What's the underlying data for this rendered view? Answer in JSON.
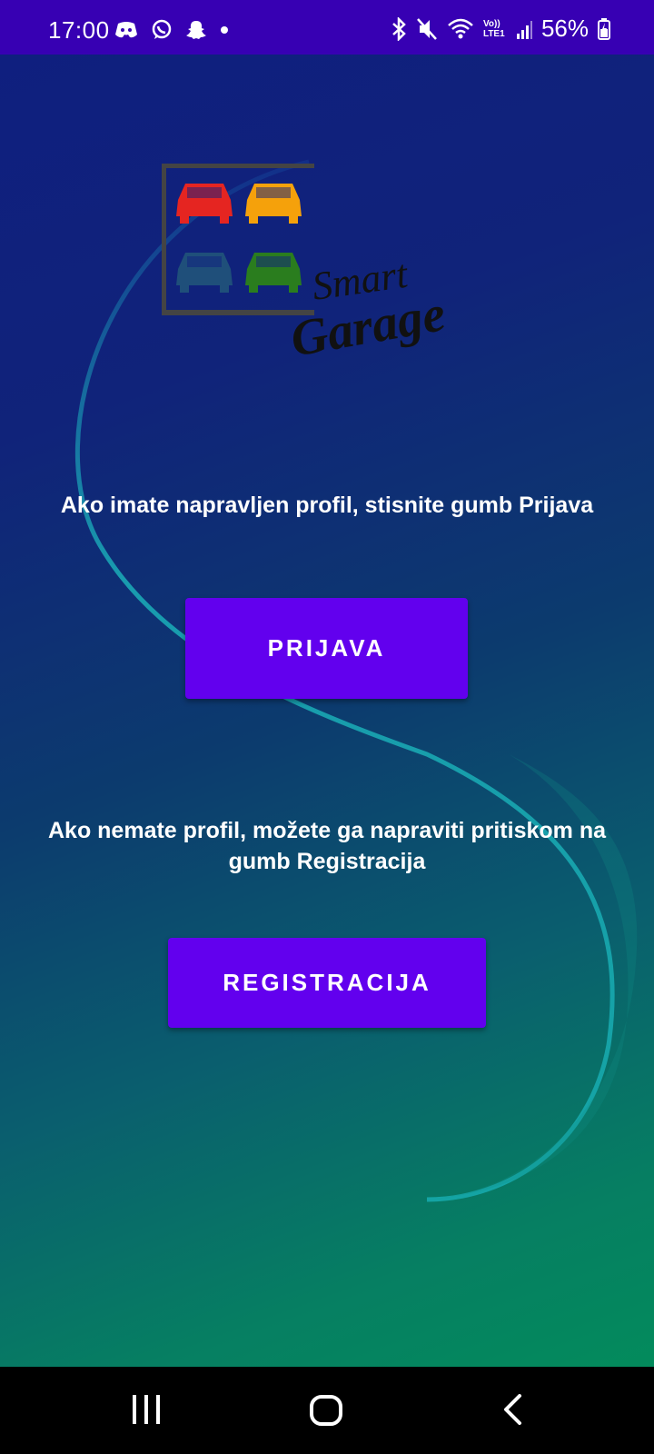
{
  "status_bar": {
    "time": "17:00",
    "battery": "56%",
    "left_icons": [
      "discord-icon",
      "whatsapp-icon",
      "snapchat-icon",
      "dot-icon"
    ],
    "right_icons": [
      "bluetooth-icon",
      "mute-icon",
      "wifi-icon",
      "lte-icon",
      "signal-icon",
      "battery-icon"
    ],
    "lte_label": "Vo)) LTE1"
  },
  "logo": {
    "line1": "Smart",
    "line2": "Garage",
    "car_colors": [
      "#e52521",
      "#f5a10b",
      "#1f4f7a",
      "#2a7d1e"
    ]
  },
  "main": {
    "login_hint": "Ako imate napravljen profil, stisnite gumb Prijava",
    "login_button": "PRIJAVA",
    "register_hint": "Ako nemate profil, možete ga napraviti pritiskom na gumb Registracija",
    "register_button": "REGISTRACIJA"
  },
  "colors": {
    "status_bar": "#3700b3",
    "button": "#6200ee"
  },
  "nav": {
    "items": [
      "recents-icon",
      "home-icon",
      "back-icon"
    ]
  }
}
